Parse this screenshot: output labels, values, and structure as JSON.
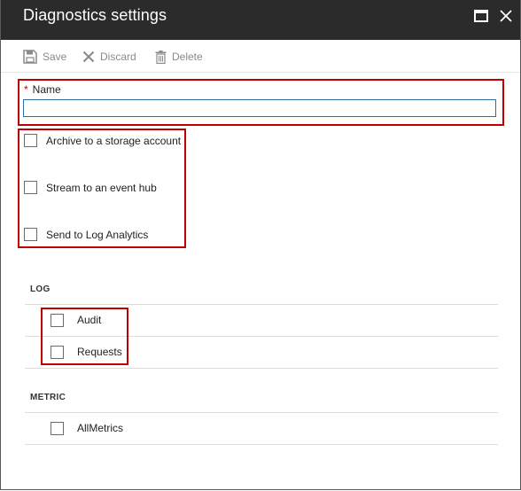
{
  "window": {
    "title": "Diagnostics settings"
  },
  "toolbar": {
    "save_label": "Save",
    "discard_label": "Discard",
    "delete_label": "Delete"
  },
  "form": {
    "name_required_marker": "*",
    "name_label": "Name",
    "name_value": "",
    "destinations": [
      {
        "label": "Archive to a storage account",
        "checked": false
      },
      {
        "label": "Stream to an event hub",
        "checked": false
      },
      {
        "label": "Send to Log Analytics",
        "checked": false
      }
    ]
  },
  "log": {
    "heading": "LOG",
    "items": [
      {
        "label": "Audit",
        "checked": false
      },
      {
        "label": "Requests",
        "checked": false
      }
    ]
  },
  "metric": {
    "heading": "METRIC",
    "items": [
      {
        "label": "AllMetrics",
        "checked": false
      }
    ]
  },
  "colors": {
    "titlebar_bg": "#2b2b2b",
    "highlight_red": "#c00000",
    "input_border": "#2e6da4"
  },
  "icons": {
    "save": "save-icon",
    "discard": "close-icon",
    "delete": "trash-icon",
    "maximize": "maximize-icon",
    "close": "close-icon"
  }
}
